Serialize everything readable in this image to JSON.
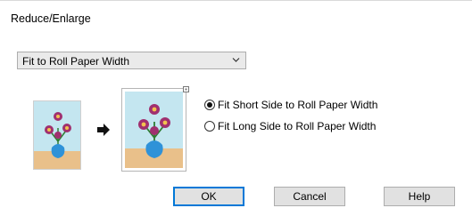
{
  "dialog": {
    "title": "Reduce/Enlarge"
  },
  "mode_select": {
    "value": "Fit to Roll Paper Width"
  },
  "options": [
    {
      "label": "Fit Short Side to Roll Paper Width",
      "checked": true
    },
    {
      "label": "Fit Long Side to Roll Paper Width",
      "checked": false
    }
  ],
  "buttons": {
    "ok": "OK",
    "cancel": "Cancel",
    "help": "Help"
  },
  "colors": {
    "accent": "#0078d7",
    "preview_sky": "#c4e6f0",
    "preview_ground": "#e9c08a",
    "flower": "#a0306f",
    "vase": "#2f92d8"
  }
}
